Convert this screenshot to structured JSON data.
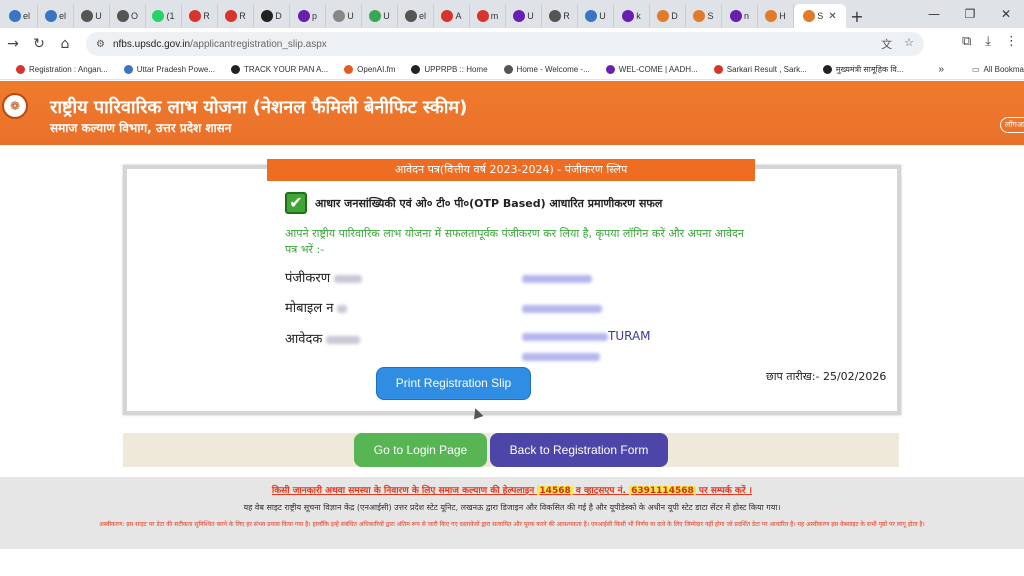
{
  "browser": {
    "tabs": [
      {
        "icon": "globe-icon",
        "label": "el",
        "color": "#3a75c4"
      },
      {
        "icon": "globe-icon",
        "label": "el",
        "color": "#3a75c4"
      },
      {
        "icon": "globe-icon",
        "label": "U",
        "color": "#555555"
      },
      {
        "icon": "globe-icon",
        "label": "O",
        "color": "#555555"
      },
      {
        "icon": "whatsapp-icon",
        "label": "(1",
        "color": "#25d366"
      },
      {
        "icon": "news-icon",
        "label": "R",
        "color": "#d9342b"
      },
      {
        "icon": "news-icon",
        "label": "R",
        "color": "#d9342b"
      },
      {
        "icon": "globe-icon",
        "label": "D",
        "color": "#222222"
      },
      {
        "icon": "yahoo-icon",
        "label": "p",
        "color": "#6b1fb1"
      },
      {
        "icon": "cube-icon",
        "label": "U",
        "color": "#888888"
      },
      {
        "icon": "globe-icon",
        "label": "U",
        "color": "#3aa655"
      },
      {
        "icon": "globe-icon",
        "label": "el",
        "color": "#555555"
      },
      {
        "icon": "wifi-icon",
        "label": "A",
        "color": "#d9342b"
      },
      {
        "icon": "wifi-icon",
        "label": "m",
        "color": "#d9342b"
      },
      {
        "icon": "yahoo-icon",
        "label": "U",
        "color": "#6b1fb1"
      },
      {
        "icon": "globe-icon",
        "label": "R",
        "color": "#555555"
      },
      {
        "icon": "shield-icon",
        "label": "U",
        "color": "#3a75c4"
      },
      {
        "icon": "yahoo-icon",
        "label": "k",
        "color": "#6b1fb1"
      },
      {
        "icon": "emblem-icon",
        "label": "D",
        "color": "#e07b2a"
      },
      {
        "icon": "emblem-icon",
        "label": "S",
        "color": "#e07b2a"
      },
      {
        "icon": "yahoo-icon",
        "label": "n",
        "color": "#6b1fb1"
      },
      {
        "icon": "emblem-icon",
        "label": "H",
        "color": "#e07b2a"
      }
    ],
    "active_tab": {
      "label": "S",
      "color": "#e07b2a"
    },
    "url_host": "nfbs.upsdc.gov.in",
    "url_path": "/applicantregistration_slip.aspx",
    "bookmarks": [
      {
        "label": "Registration : Angan...",
        "color": "#d9342b"
      },
      {
        "label": "Uttar Pradesh Powe...",
        "color": "#3a75c4"
      },
      {
        "label": "TRACK YOUR PAN A...",
        "color": "#222222"
      },
      {
        "label": "OpenAI.fm",
        "color": "#e85a1e"
      },
      {
        "label": "UPPRPB :: Home",
        "color": "#222222"
      },
      {
        "label": "Home - Welcome -...",
        "color": "#555555"
      },
      {
        "label": "WEL-COME | AADH...",
        "color": "#6b1fb1"
      },
      {
        "label": "Sarkari Result , Sark...",
        "color": "#d9342b"
      },
      {
        "label": "मुख्यमंत्री सामूहिक वि...",
        "color": "#222222"
      }
    ],
    "bookmarks_more": "»",
    "all_bookmarks": "All Bookma"
  },
  "header": {
    "title": "राष्ट्रीय पारिवारिक लाभ योजना (नेशनल फैमिली बेनीफिट स्कीम)",
    "subtitle": "समाज कल्याण विभाग, उत्तर प्रदेश शासन",
    "right_button": "लॉगआ"
  },
  "slip": {
    "heading": "आवेदन पत्र(वित्तीय वर्ष 2023-2024) - पंजीकरण स्लिप",
    "success_text": "आधार जनसांख्यिकी एवं ओ० टी० पी०(OTP Based) आधारित प्रमाणीकरण सफल",
    "message": "आपने राष्ट्रीय पारिवारिक लाभ योजना में सफलतापूर्वक पंजीकरण कर लिया है, कृपया लॉगिन करें और अपना आवेदन पत्र भरें :-",
    "labels": {
      "registration": "पंजीकरण",
      "mobile": "मोबाइल न",
      "applicant": "आवेदक"
    },
    "applicant_name_visible": "TURAM",
    "print_button": "Print Registration Slip",
    "print_date_label": "छाप तारीख:-",
    "print_date_value": "25/02/2026"
  },
  "actions": {
    "login": "Go to Login Page",
    "back": "Back to Registration Form"
  },
  "footer": {
    "helpline_pre": "किसी जानकारी अथवा समस्या के निवारण के लिए समाज कल्याण की हेल्पलाइन",
    "helpline_number": "14568",
    "helpline_mid": "व व्हाट्सएप नं.",
    "whatsapp_number": "6391114568",
    "helpline_post": "पर सम्पर्क करें ।",
    "hosted": "यह वेब साइट राष्ट्रीय सूचना विज्ञान केंद्र (एनआईसी) उत्तर प्रदेश स्टेट यूनिट, लखनऊ द्वारा डिजाइन और विकसित की गई है और यूपीडेस्को के अधीन यूपी स्टेट डाटा सेंटर में होस्ट किया गया।",
    "disclaimer": "अस्वीकरण: इस साइट पर डेटा की सटीकता सुनिश्चित करने के लिए हर संभव प्रयास किया गया है। हालाँकि इन्हें संबंधित अधिकारियों द्वारा अंतिम रूप से जारी किए गए दस्तावेजों द्वारा सत्यापित और पूरक करने की आवश्यकता है। एनआईसी किसी भी निर्णय या दावे के लिए जिम्मेदार नहीं होगा जो प्रदर्शित डेटा पर आधारित है। यह अस्वीकरण इस वेबसाइट के सभी पृष्ठों पर लागू होता है।"
  }
}
